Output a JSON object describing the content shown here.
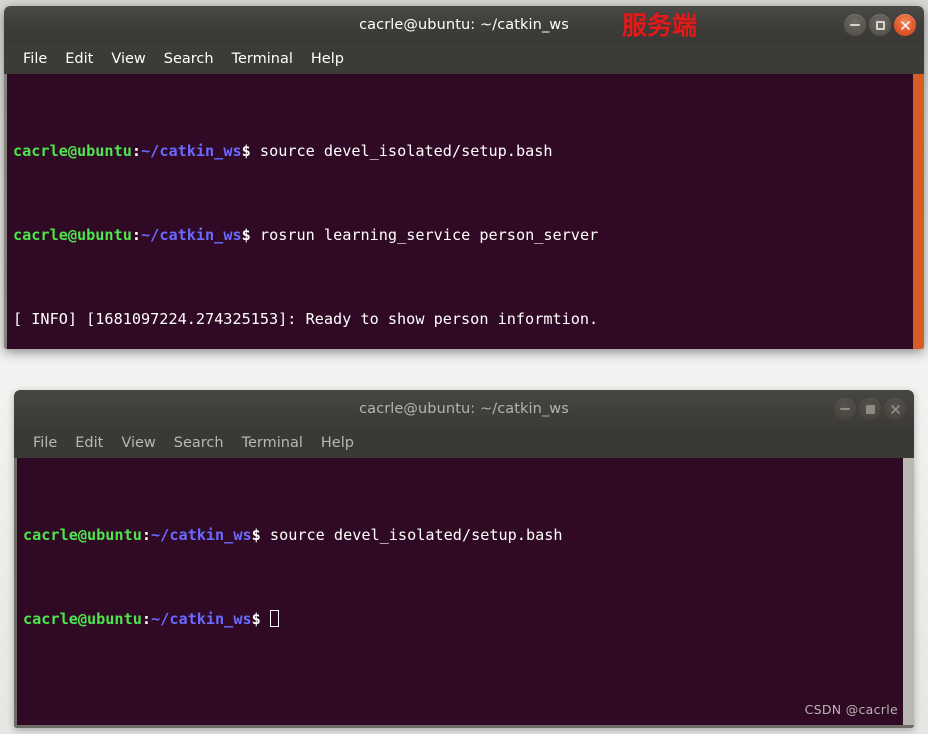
{
  "desktop": {
    "watermark": "CSDN @cacrle"
  },
  "windows": [
    {
      "id": "server-terminal",
      "focused": true,
      "title": "cacrle@ubuntu: ~/catkin_ws",
      "annotation": "服务端",
      "annotation_color": "#e01b1b",
      "controls": {
        "minimize_label": "minimize",
        "maximize_label": "maximize",
        "close_label": "close"
      },
      "menu": [
        "File",
        "Edit",
        "View",
        "Search",
        "Terminal",
        "Help"
      ],
      "scrollbar_color": "#d85c26",
      "background_color": "#300a24",
      "lines": [
        {
          "prompt_user": "cacrle@ubuntu",
          "prompt_colon": ":",
          "prompt_path": "~/catkin_ws",
          "prompt_sym": "$ ",
          "command": "source devel_isolated/setup.bash"
        },
        {
          "prompt_user": "cacrle@ubuntu",
          "prompt_colon": ":",
          "prompt_path": "~/catkin_ws",
          "prompt_sym": "$ ",
          "command": "rosrun learning_service person_server"
        },
        {
          "output": "[ INFO] [1681097224.274325153]: Ready to show person informtion."
        }
      ],
      "cursor_style": "solid"
    },
    {
      "id": "client-terminal",
      "focused": false,
      "title": "cacrle@ubuntu: ~/catkin_ws",
      "annotation": "",
      "controls": {
        "minimize_label": "minimize",
        "maximize_label": "maximize",
        "close_label": "close"
      },
      "menu": [
        "File",
        "Edit",
        "View",
        "Search",
        "Terminal",
        "Help"
      ],
      "scrollbar_color": "#b9b7b1",
      "background_color": "#300a24",
      "lines": [
        {
          "prompt_user": "cacrle@ubuntu",
          "prompt_colon": ":",
          "prompt_path": "~/catkin_ws",
          "prompt_sym": "$ ",
          "command": "source devel_isolated/setup.bash"
        },
        {
          "prompt_user": "cacrle@ubuntu",
          "prompt_colon": ":",
          "prompt_path": "~/catkin_ws",
          "prompt_sym": "$ ",
          "command": ""
        }
      ],
      "cursor_style": "hollow"
    }
  ]
}
